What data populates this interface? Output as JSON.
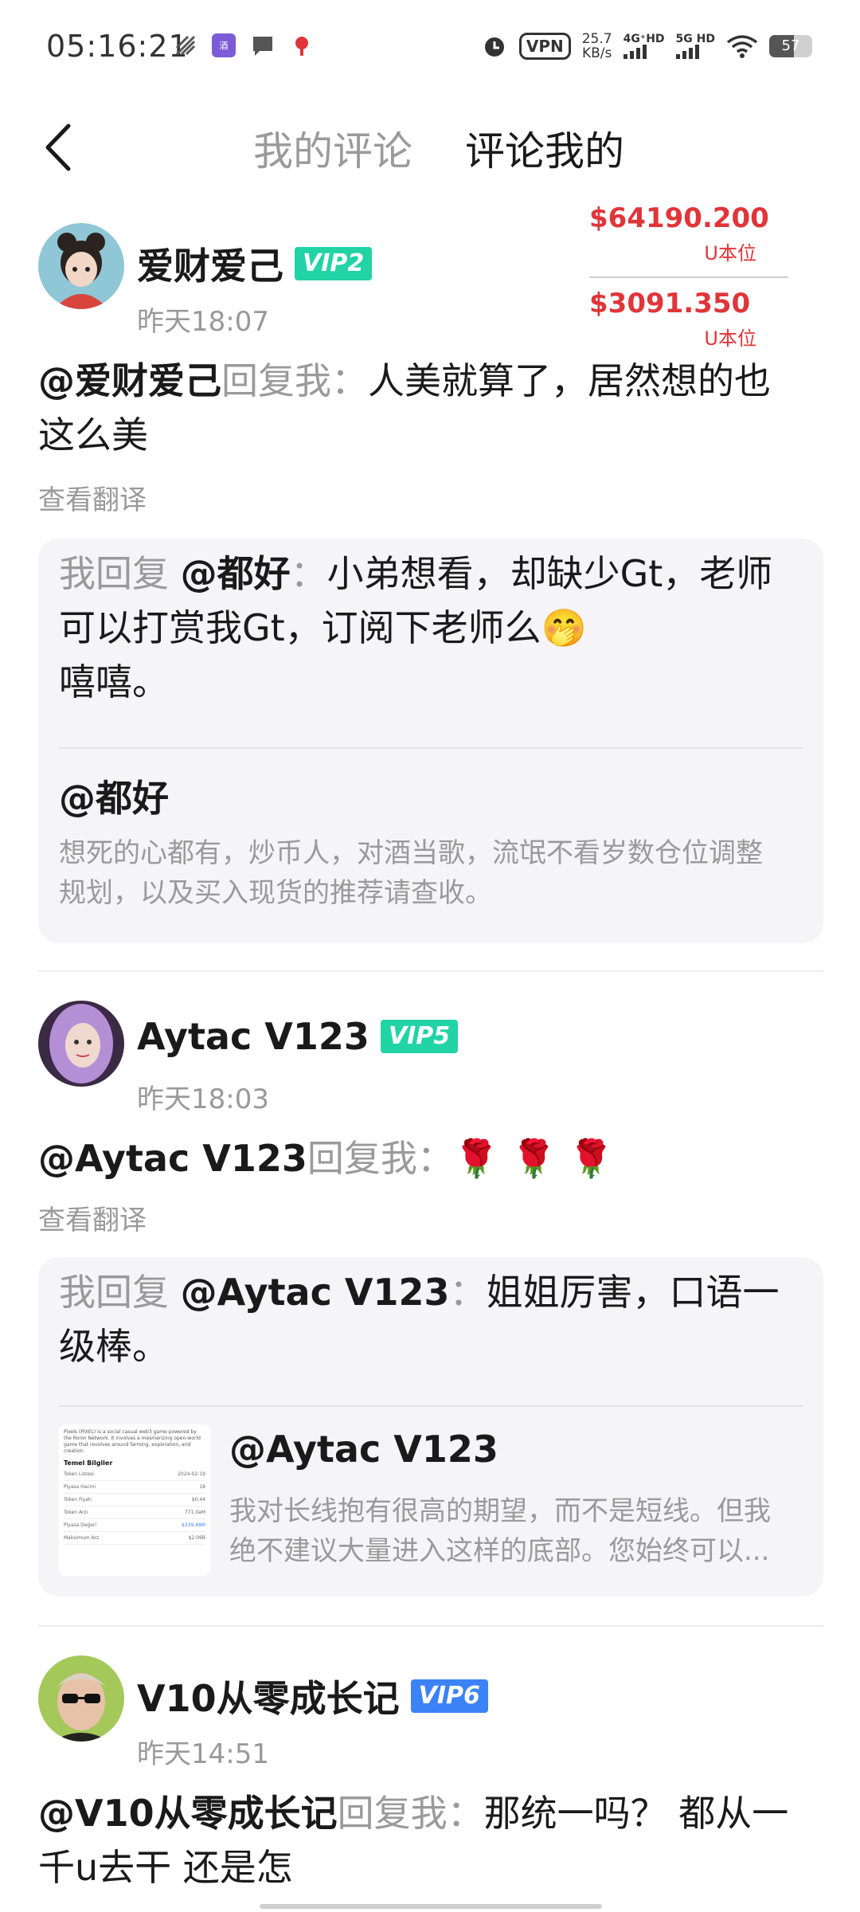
{
  "status_bar": {
    "time": "05:16:21",
    "vpn": "VPN",
    "speed_value": "25.7",
    "speed_unit": "KB/s",
    "net1": "4G⁺HD",
    "net2": "5G HD",
    "battery": "57",
    "battery_level_percent": 57
  },
  "header": {
    "tab_mine": "我的评论",
    "tab_others": "评论我的"
  },
  "prices": [
    {
      "value": "$64190.200",
      "unit": "U本位"
    },
    {
      "value": "$3091.350",
      "unit": "U本位"
    }
  ],
  "comments": [
    {
      "username": "爱财爱己",
      "vip": "VIP2",
      "vip_color": "#22d3a6",
      "time": "昨天18:07",
      "at": "@爱财爱己",
      "reply_label": "回复我：",
      "text_line1": "人美就算了，居然想的也",
      "text_line2": "这么美",
      "translate": "查看翻译",
      "reply": {
        "prefix": "我回复 ",
        "at": "@都好",
        "colon": "：",
        "line1": "小弟想看，却缺少Gt，老师",
        "line2": "可以打赏我Gt，订阅下老师么",
        "line3": "嘻嘻。",
        "emoji": "🤭"
      },
      "original": {
        "at": "@都好",
        "line1": "想死的心都有，炒币人，对酒当歌，流氓不看岁数仓位调整",
        "line2": "规划，以及买入现货的推荐请查收。"
      }
    },
    {
      "username": "Aytac V123",
      "vip": "VIP5",
      "vip_color": "#22d3a6",
      "time": "昨天18:03",
      "at": "@Aytac V123",
      "reply_label": "回复我：",
      "text_line1": "🌹 🌹 🌹",
      "translate": "查看翻译",
      "reply": {
        "prefix": "我回复 ",
        "at": "@Aytac V123",
        "colon": "：",
        "line1": "姐姐厉害，口语一",
        "line2": "级棒。"
      },
      "original": {
        "at": "@Aytac V123",
        "line1": "我对长线抱有很高的期望，而不是短线。但我",
        "line2": "绝不建议大量进入这样的底部。您始终可以...",
        "thumb_title": "Temel Bilgiler",
        "thumb_intro": "Pixels (PIXEL) is a social casual web3 game powered by the Ronin Network. It involves a mesmerizing open-world game that revolves around farming, exploration, and creation.",
        "thumb_rows": [
          {
            "k": "Token Listesi",
            "v": "2024-02-19"
          },
          {
            "k": "Piyasa Hacmi",
            "v": "18"
          },
          {
            "k": "Token Fiyatı",
            "v": "$0.44"
          },
          {
            "k": "Token Arzı",
            "v": "771.0aM"
          },
          {
            "k": "Piyasa Değeri",
            "v": "$339.48M"
          },
          {
            "k": "Maksimum Arz",
            "v": "$2.06B"
          }
        ]
      }
    },
    {
      "username": "V10从零成长记",
      "vip": "VIP6",
      "vip_color": "#3b82f6",
      "time": "昨天14:51",
      "at": "@V10从零成长记",
      "reply_label": "回复我：",
      "text_line1": "那统一吗？ 都从一",
      "text_line2": "千u去干 还是怎"
    }
  ]
}
